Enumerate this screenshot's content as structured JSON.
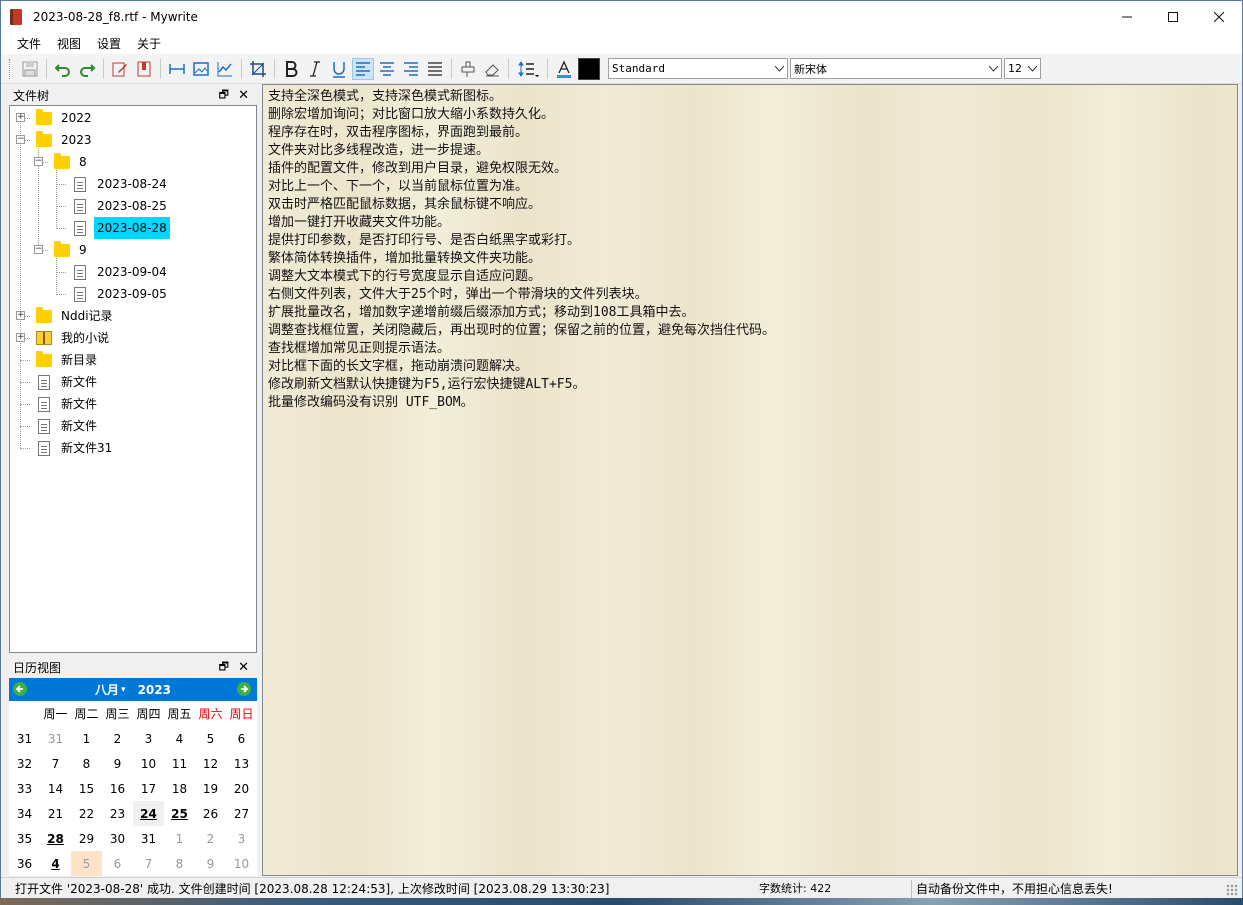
{
  "window": {
    "title": "2023-08-28_f8.rtf - Mywrite",
    "minimize": "—",
    "maximize": "☐",
    "close": "✕"
  },
  "menu": [
    "文件",
    "视图",
    "设置",
    "关于"
  ],
  "toolbar": {
    "style_value": "Standard",
    "font_value": "新宋体",
    "size_value": "12",
    "text_color": "#000000",
    "icons": [
      "save-icon",
      "undo-icon",
      "redo-icon",
      "edit-icon",
      "bookmark-icon",
      "width-icon",
      "image-icon",
      "chart-icon",
      "crop-icon",
      "bold-icon",
      "italic-icon",
      "underline-icon",
      "align-left-icon",
      "align-center-icon",
      "align-right-icon",
      "justify-icon",
      "format-painter-icon",
      "eraser-icon",
      "line-spacing-icon",
      "font-color-icon"
    ]
  },
  "file_tree": {
    "title": "文件树",
    "pin": "🗗",
    "close": "✕",
    "items": [
      {
        "label": "2022",
        "type": "folder",
        "level": 0,
        "expander": "+"
      },
      {
        "label": "2023",
        "type": "folder",
        "level": 0,
        "expander": "−"
      },
      {
        "label": "8",
        "type": "folder",
        "level": 1,
        "expander": "−"
      },
      {
        "label": "2023-08-24",
        "type": "doc",
        "level": 2
      },
      {
        "label": "2023-08-25",
        "type": "doc",
        "level": 2
      },
      {
        "label": "2023-08-28",
        "type": "doc",
        "level": 2,
        "selected": true
      },
      {
        "label": "9",
        "type": "folder",
        "level": 1,
        "expander": "−"
      },
      {
        "label": "2023-09-04",
        "type": "doc",
        "level": 2
      },
      {
        "label": "2023-09-05",
        "type": "doc",
        "level": 2
      },
      {
        "label": "Nddi记录",
        "type": "folder",
        "level": 0,
        "expander": "+"
      },
      {
        "label": "我的小说",
        "type": "book",
        "level": 0,
        "expander": "+"
      },
      {
        "label": "新目录",
        "type": "folder",
        "level": 0
      },
      {
        "label": "新文件",
        "type": "doc",
        "level": 0
      },
      {
        "label": "新文件",
        "type": "doc",
        "level": 0
      },
      {
        "label": "新文件",
        "type": "doc",
        "level": 0
      },
      {
        "label": "新文件31",
        "type": "doc",
        "level": 0
      }
    ]
  },
  "calendar": {
    "title": "日历视图",
    "pin": "🗗",
    "close": "✕",
    "month_label": "八月",
    "year_label": "2023",
    "prev": "◀",
    "next": "▶",
    "weekdays": [
      "周一",
      "周二",
      "周三",
      "周四",
      "周五",
      "周六",
      "周日"
    ],
    "weeks": [
      {
        "wk": "31",
        "days": [
          "31",
          "1",
          "2",
          "3",
          "4",
          "5",
          "6"
        ]
      },
      {
        "wk": "32",
        "days": [
          "7",
          "8",
          "9",
          "10",
          "11",
          "12",
          "13"
        ]
      },
      {
        "wk": "33",
        "days": [
          "14",
          "15",
          "16",
          "17",
          "18",
          "19",
          "20"
        ]
      },
      {
        "wk": "34",
        "days": [
          "21",
          "22",
          "23",
          "24",
          "25",
          "26",
          "27"
        ]
      },
      {
        "wk": "35",
        "days": [
          "28",
          "29",
          "30",
          "31",
          "1",
          "2",
          "3"
        ]
      },
      {
        "wk": "36",
        "days": [
          "4",
          "5",
          "6",
          "7",
          "8",
          "9",
          "10"
        ]
      }
    ]
  },
  "editor": {
    "lines": [
      "支持全深色模式，支持深色模式新图标。",
      "删除宏增加询问；对比窗口放大缩小系数持久化。",
      "程序存在时，双击程序图标，界面跑到最前。",
      "文件夹对比多线程改造，进一步提速。",
      "插件的配置文件，修改到用户目录，避免权限无效。",
      "对比上一个、下一个，以当前鼠标位置为准。",
      "双击时严格匹配鼠标数据，其余鼠标键不响应。",
      "增加一键打开收藏夹文件功能。",
      "提供打印参数，是否打印行号、是否白纸黑字或彩打。",
      "繁体简体转换插件，增加批量转换文件夹功能。",
      "调整大文本模式下的行号宽度显示自适应问题。",
      "右侧文件列表，文件大于25个时，弹出一个带滑块的文件列表块。",
      "扩展批量改名，增加数字递增前缀后缀添加方式；移动到108工具箱中去。",
      "调整查找框位置，关闭隐藏后，再出现时的位置；保留之前的位置，避免每次挡住代码。",
      "查找框增加常见正则提示语法。",
      "对比框下面的长文字框，拖动崩溃问题解决。",
      "修改刷新文档默认快捷键为F5,运行宏快捷键ALT+F5。",
      "批量修改编码没有识别 UTF_BOM。"
    ]
  },
  "status": {
    "message": "打开文件 '2023-08-28' 成功. 文件创建时间 [2023.08.28 12:24:53], 上次修改时间 [2023.08.29 13:30:23]",
    "word_count": "字数统计: 422",
    "backup": "自动备份文件中，不用担心信息丢失!"
  }
}
